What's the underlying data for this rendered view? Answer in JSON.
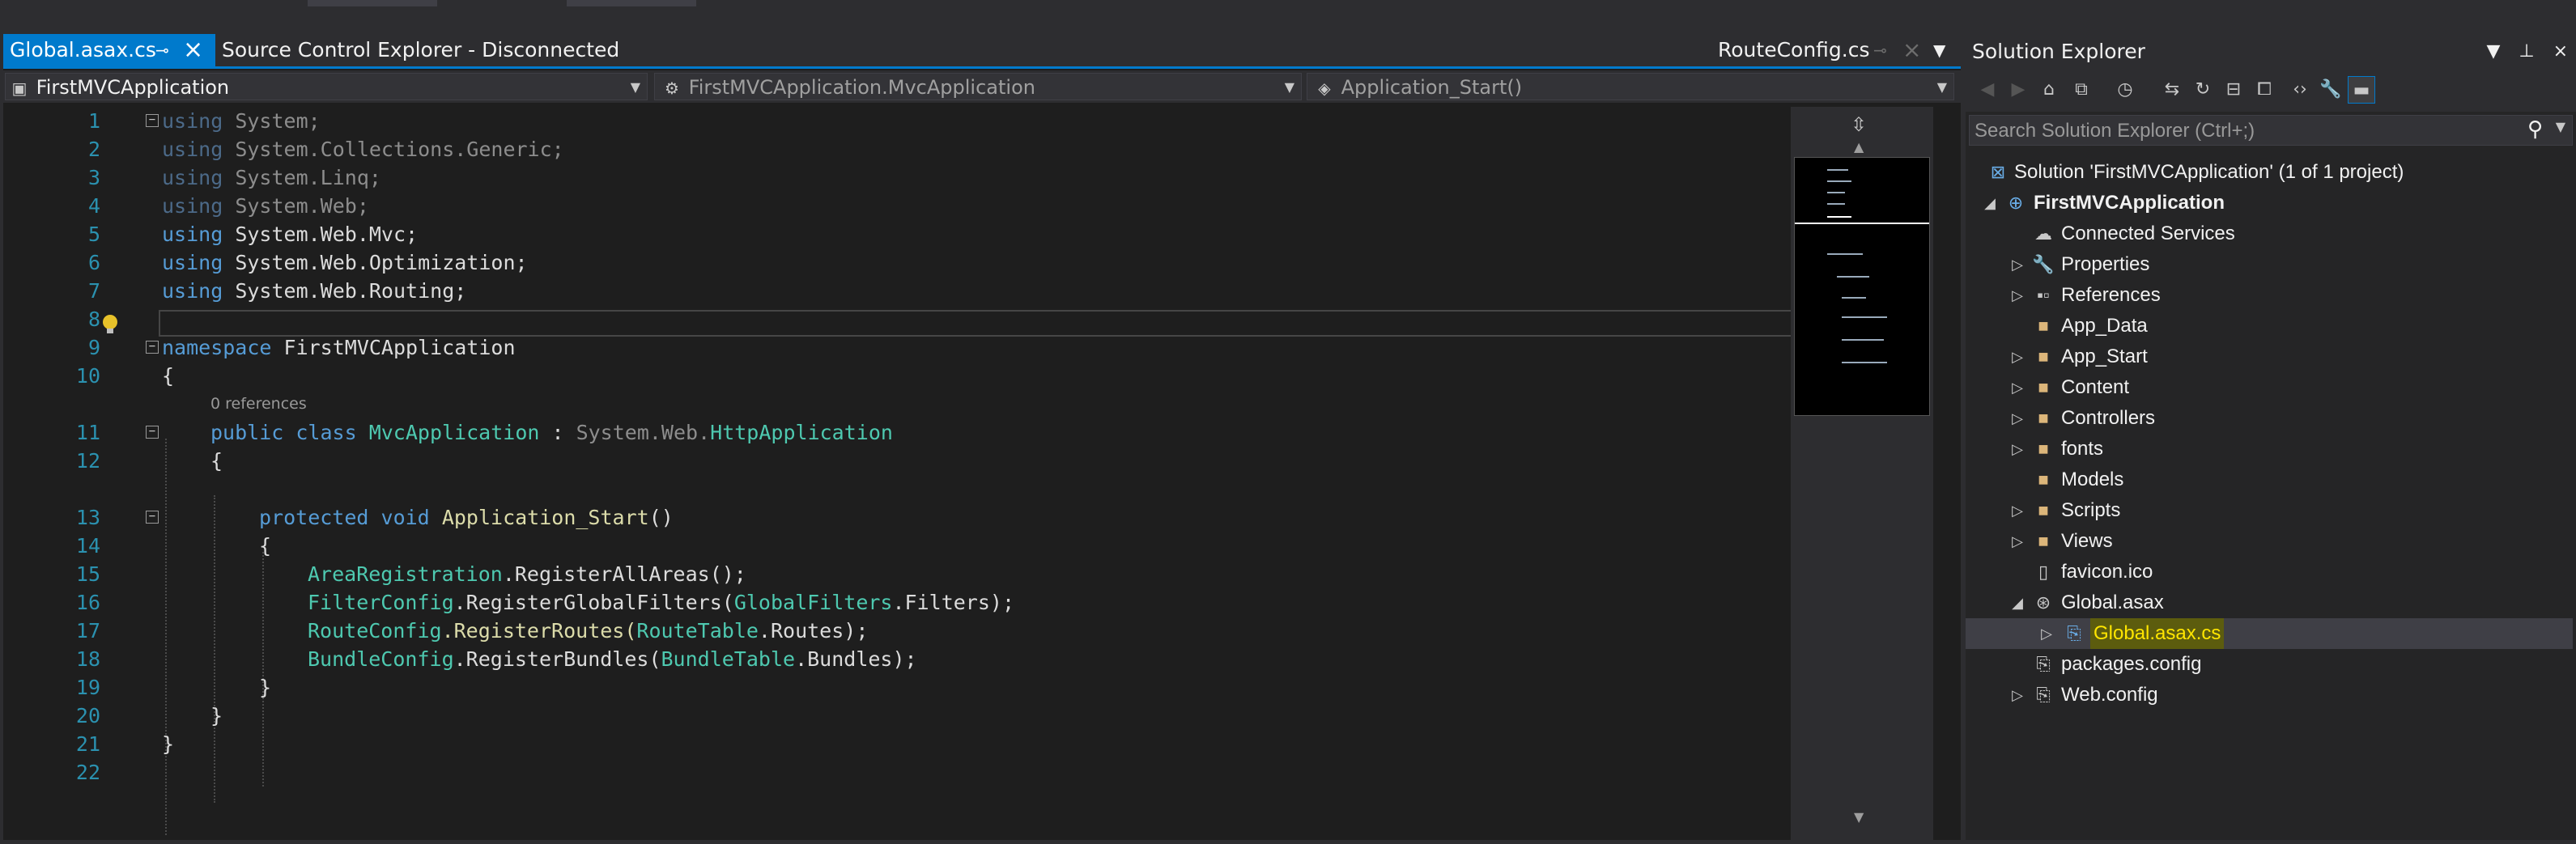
{
  "editor": {
    "tabs": {
      "active": "Global.asax.cs",
      "inactive": "Source Control Explorer - Disconnected",
      "right": "RouteConfig.cs"
    },
    "nav": {
      "project": "FirstMVCApplication",
      "class": "FirstMVCApplication.MvcApplication",
      "member": "Application_Start()"
    },
    "code_lines": [
      {
        "n": "1"
      },
      {
        "n": "2"
      },
      {
        "n": "3"
      },
      {
        "n": "4"
      },
      {
        "n": "5"
      },
      {
        "n": "6"
      },
      {
        "n": "7"
      },
      {
        "n": "8"
      },
      {
        "n": "9"
      },
      {
        "n": "10"
      },
      {
        "n": "11"
      },
      {
        "n": "12"
      },
      {
        "n": "13"
      },
      {
        "n": "14"
      },
      {
        "n": "15"
      },
      {
        "n": "16"
      },
      {
        "n": "17"
      },
      {
        "n": "18"
      },
      {
        "n": "19"
      },
      {
        "n": "20"
      },
      {
        "n": "21"
      },
      {
        "n": "22"
      }
    ],
    "code": {
      "l1": {
        "kw": "using",
        "rest": " System;"
      },
      "l2": {
        "kw": "using",
        "rest": " System.Collections.Generic;"
      },
      "l3": {
        "kw": "using",
        "rest": " System.Linq;"
      },
      "l4": {
        "kw": "using",
        "rest": " System.Web;"
      },
      "l5": {
        "kw": "using",
        "rest": " System.Web.Mvc;"
      },
      "l6": {
        "kw": "using",
        "rest": " System.Web.Optimization;"
      },
      "l7": {
        "kw": "using",
        "rest": " System.Web.Routing;"
      },
      "l9": {
        "kw": "namespace",
        "rest": " FirstMVCApplication"
      },
      "l10": "{",
      "refs": "0 references",
      "l11": {
        "kw1": "public",
        "kw2": "class",
        "name": "MvcApplication",
        "colon": " : ",
        "base_dim": "System.Web.",
        "base": "HttpApplication"
      },
      "l12": "{",
      "l13": {
        "kw1": "protected",
        "kw2": "void",
        "name": "Application_Start",
        "tail": "()"
      },
      "l14": "{",
      "l15": {
        "t": "AreaRegistration",
        "rest": ".RegisterAllAreas();"
      },
      "l16": {
        "t": "FilterConfig",
        "m": ".RegisterGlobalFilters(",
        "t2": "GlobalFilters",
        "rest": ".Filters);"
      },
      "l17": {
        "t": "RouteConfig",
        "m": ".RegisterRoutes(",
        "t2": "RouteTable",
        "rest": ".Routes);"
      },
      "l18": {
        "t": "BundleConfig",
        "m": ".RegisterBundles(",
        "t2": "BundleTable",
        "rest": ".Bundles);"
      },
      "l19": "}",
      "l20": "}",
      "l21": "}"
    }
  },
  "solution_explorer": {
    "title": "Solution Explorer",
    "search_placeholder": "Search Solution Explorer (Ctrl+;)",
    "items": [
      {
        "label": "Solution 'FirstMVCApplication' (1 of 1 project)"
      },
      {
        "label": "FirstMVCApplication"
      },
      {
        "label": "Connected Services"
      },
      {
        "label": "Properties"
      },
      {
        "label": "References"
      },
      {
        "label": "App_Data"
      },
      {
        "label": "App_Start"
      },
      {
        "label": "Content"
      },
      {
        "label": "Controllers"
      },
      {
        "label": "fonts"
      },
      {
        "label": "Models"
      },
      {
        "label": "Scripts"
      },
      {
        "label": "Views"
      },
      {
        "label": "favicon.ico"
      },
      {
        "label": "Global.asax"
      },
      {
        "label": "Global.asax.cs"
      },
      {
        "label": "packages.config"
      },
      {
        "label": "Web.config"
      }
    ]
  },
  "colors": {
    "accent": "#007acc",
    "editor_bg": "#1e1e1e",
    "keyword": "#569cd6",
    "type": "#4ec9b0",
    "method": "#dcdcaa",
    "line_number": "#2b91af"
  }
}
